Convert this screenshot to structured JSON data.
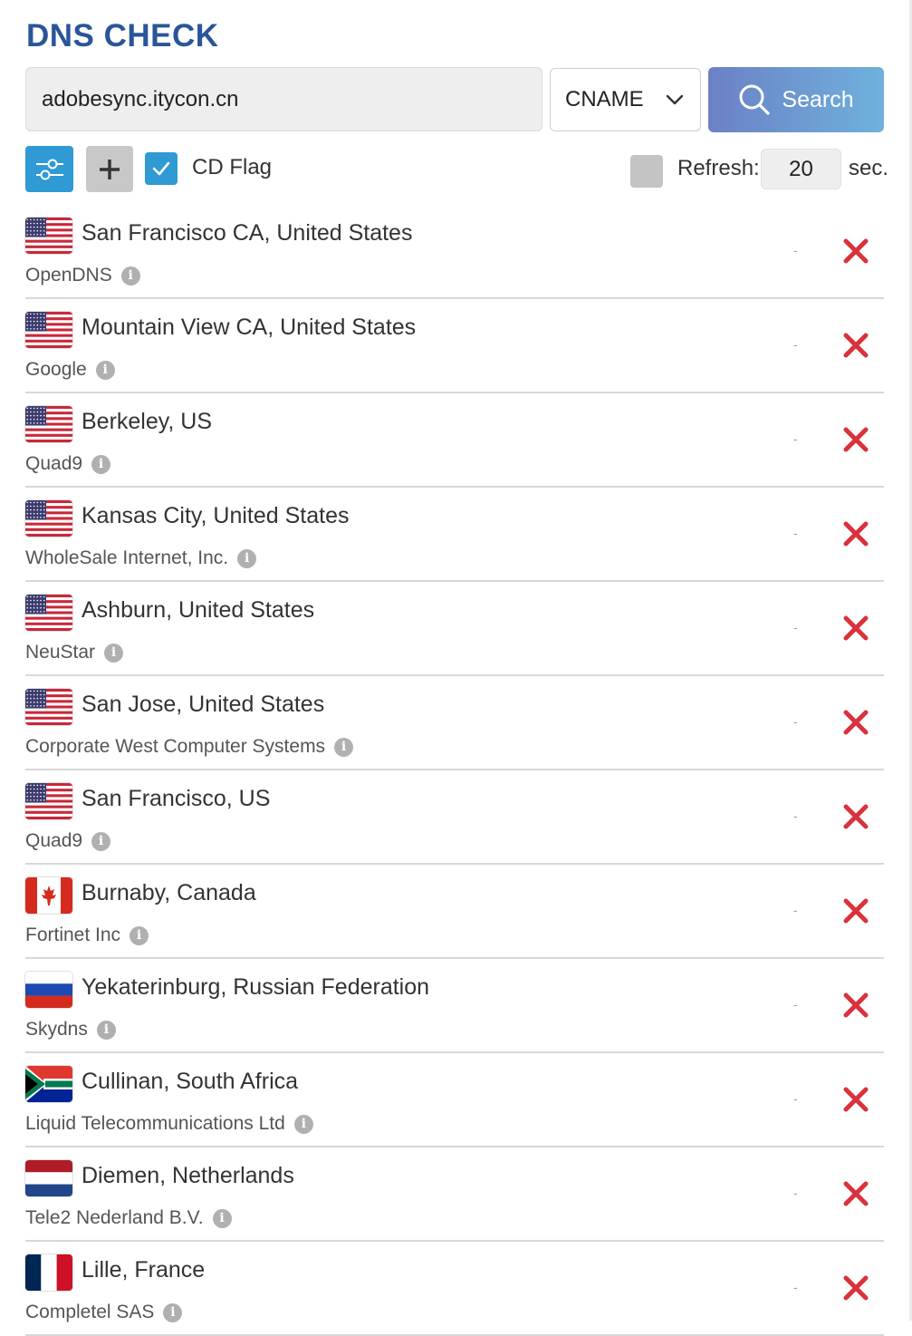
{
  "app": {
    "title": "DNS CHECK"
  },
  "query": {
    "domain": "adobesync.itycon.cn",
    "record_type": "CNAME",
    "search_label": "Search"
  },
  "options": {
    "cd_flag_label": "CD Flag",
    "cd_flag_checked": true,
    "refresh_checked": false,
    "refresh_label": "Refresh:",
    "refresh_value": "20",
    "refresh_unit": "sec."
  },
  "colors": {
    "title": "#2a5599",
    "accent": "#2f9ad4",
    "fail": "#d9323c",
    "search_gradient": [
      "#6b81c5",
      "#6fb1dc"
    ]
  },
  "servers": [
    {
      "flag": "us",
      "location": "San Francisco CA, United States",
      "provider": "OpenDNS",
      "result": "-",
      "status": "fail"
    },
    {
      "flag": "us",
      "location": "Mountain View CA, United States",
      "provider": "Google",
      "result": "-",
      "status": "fail"
    },
    {
      "flag": "us",
      "location": "Berkeley, US",
      "provider": "Quad9",
      "result": "-",
      "status": "fail"
    },
    {
      "flag": "us",
      "location": "Kansas City, United States",
      "provider": "WholeSale Internet, Inc.",
      "result": "-",
      "status": "fail"
    },
    {
      "flag": "us",
      "location": "Ashburn, United States",
      "provider": "NeuStar",
      "result": "-",
      "status": "fail"
    },
    {
      "flag": "us",
      "location": "San Jose, United States",
      "provider": "Corporate West Computer Systems",
      "result": "-",
      "status": "fail"
    },
    {
      "flag": "us",
      "location": "San Francisco, US",
      "provider": "Quad9",
      "result": "-",
      "status": "fail"
    },
    {
      "flag": "ca",
      "location": "Burnaby, Canada",
      "provider": "Fortinet Inc",
      "result": "-",
      "status": "fail"
    },
    {
      "flag": "ru",
      "location": "Yekaterinburg, Russian Federation",
      "provider": "Skydns",
      "result": "-",
      "status": "fail"
    },
    {
      "flag": "za",
      "location": "Cullinan, South Africa",
      "provider": "Liquid Telecommunications Ltd",
      "result": "-",
      "status": "fail"
    },
    {
      "flag": "nl",
      "location": "Diemen, Netherlands",
      "provider": "Tele2 Nederland B.V.",
      "result": "-",
      "status": "fail"
    },
    {
      "flag": "fr",
      "location": "Lille, France",
      "provider": "Completel SAS",
      "result": "-",
      "status": "fail"
    }
  ]
}
